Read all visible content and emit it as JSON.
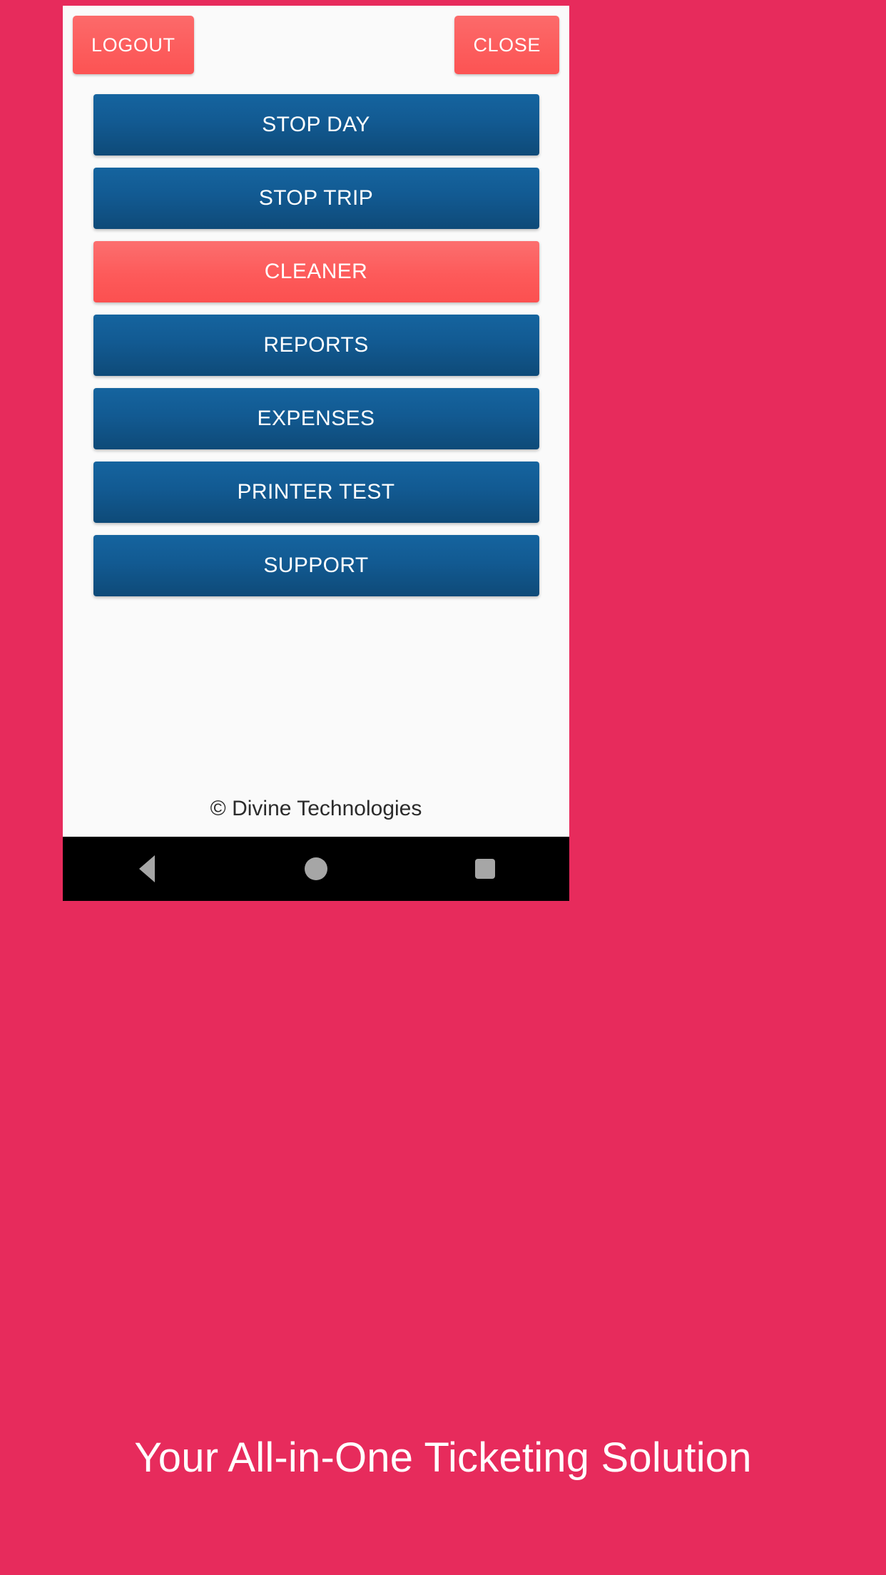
{
  "theme": {
    "page_background": "#e72b5c",
    "screen_background": "#fafafa",
    "blue_accent": "#15649f",
    "blue_accent_dark": "#0e4a78",
    "red_accent": "#fc6a6a",
    "nav_bar_background": "#000000",
    "nav_icon_color": "#a6a6a6",
    "button_text_color": "#ffffff"
  },
  "top_bar": {
    "logout_label": "LOGOUT",
    "close_label": "CLOSE"
  },
  "actions": [
    {
      "label": "STOP DAY",
      "style": "blue",
      "icon": "stop-day-icon"
    },
    {
      "label": "STOP TRIP",
      "style": "blue",
      "icon": "stop-trip-icon"
    },
    {
      "label": "CLEANER",
      "style": "red",
      "icon": "cleaner-icon"
    },
    {
      "label": "REPORTS",
      "style": "blue",
      "icon": "reports-icon"
    },
    {
      "label": "EXPENSES",
      "style": "blue",
      "icon": "expenses-icon"
    },
    {
      "label": "PRINTER TEST",
      "style": "blue",
      "icon": "printer-test-icon"
    },
    {
      "label": "SUPPORT",
      "style": "blue",
      "icon": "support-icon"
    }
  ],
  "footer": {
    "copyright": "© Divine Technologies"
  },
  "nav_bar": {
    "back_icon": "back-triangle-icon",
    "home_icon": "home-circle-icon",
    "recent_icon": "recent-apps-square-icon"
  },
  "tagline": {
    "text": "Your All-in-One Ticketing Solution"
  }
}
